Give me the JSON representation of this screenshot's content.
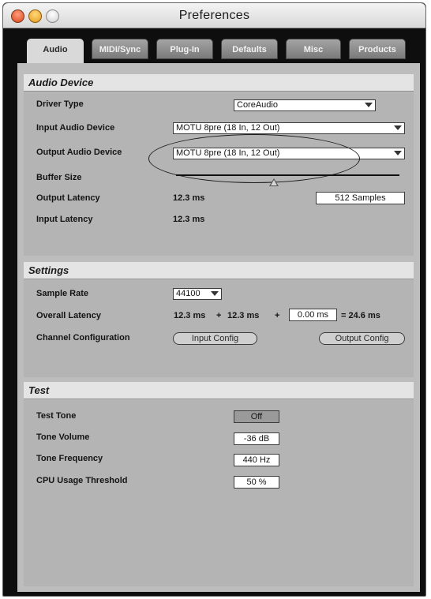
{
  "window": {
    "title": "Preferences"
  },
  "tabs": [
    {
      "label": "Audio",
      "active": true
    },
    {
      "label": "MIDI/Sync",
      "active": false
    },
    {
      "label": "Plug-In",
      "active": false
    },
    {
      "label": "Defaults",
      "active": false
    },
    {
      "label": "Misc",
      "active": false
    },
    {
      "label": "Products",
      "active": false
    }
  ],
  "audio_device": {
    "heading": "Audio Device",
    "driver_type_label": "Driver Type",
    "driver_type_value": "CoreAudio",
    "input_device_label": "Input Audio Device",
    "input_device_value": "MOTU 8pre (18 In, 12 Out)",
    "output_device_label": "Output Audio Device",
    "output_device_value": "MOTU 8pre (18 In, 12 Out)",
    "buffer_size_label": "Buffer Size",
    "output_latency_label": "Output Latency",
    "output_latency_value": "12.3 ms",
    "buffer_samples": "512 Samples",
    "input_latency_label": "Input Latency",
    "input_latency_value": "12.3 ms"
  },
  "settings": {
    "heading": "Settings",
    "sample_rate_label": "Sample Rate",
    "sample_rate_value": "44100",
    "overall_latency_label": "Overall Latency",
    "latency_a": "12.3 ms",
    "plus_1": "+",
    "latency_b": "12.3 ms",
    "plus_2": "+",
    "latency_extra": "0.00 ms",
    "latency_total": "= 24.6 ms",
    "channel_config_label": "Channel Configuration",
    "input_config_button": "Input Config",
    "output_config_button": "Output Config"
  },
  "test": {
    "heading": "Test",
    "test_tone_label": "Test Tone",
    "test_tone_value": "Off",
    "tone_volume_label": "Tone Volume",
    "tone_volume_value": "-36 dB",
    "tone_frequency_label": "Tone Frequency",
    "tone_frequency_value": "440 Hz",
    "cpu_threshold_label": "CPU Usage Threshold",
    "cpu_threshold_value": "50 %"
  }
}
